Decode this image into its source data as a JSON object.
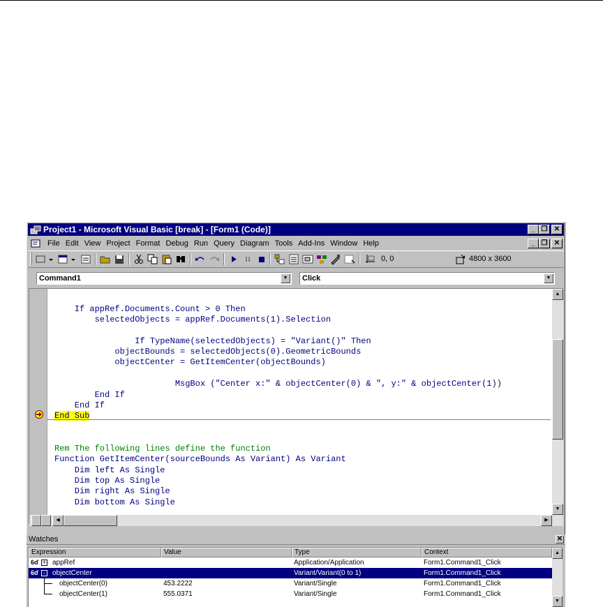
{
  "window": {
    "title": "Project1 - Microsoft Visual Basic [break] - [Form1 (Code)]"
  },
  "menu": [
    "File",
    "Edit",
    "View",
    "Project",
    "Format",
    "Debug",
    "Run",
    "Query",
    "Diagram",
    "Tools",
    "Add-Ins",
    "Window",
    "Help"
  ],
  "toolbar": {
    "position_readout": "0, 0",
    "size_readout": "4800 x 3600"
  },
  "code_window": {
    "object_combo": "Command1",
    "procedure_combo": "Click",
    "lines": [
      {
        "text": "    If appRef.Documents.Count > 0 Then",
        "style": "code"
      },
      {
        "text": "        selectedObjects = appRef.Documents(1).Selection",
        "style": "code"
      },
      {
        "text": "",
        "style": "code"
      },
      {
        "text": "                If TypeName(selectedObjects) = \"Variant()\" Then",
        "style": "code"
      },
      {
        "text": "            objectBounds = selectedObjects(0).GeometricBounds",
        "style": "code"
      },
      {
        "text": "            objectCenter = GetItemCenter(objectBounds)",
        "style": "code"
      },
      {
        "text": "",
        "style": "code"
      },
      {
        "text": "                        MsgBox (\"Center x:\" & objectCenter(0) & \", y:\" & objectCenter(1))",
        "style": "code"
      },
      {
        "text": "        End If",
        "style": "code"
      },
      {
        "text": "    End If",
        "style": "code"
      },
      {
        "text": "End Sub",
        "style": "current"
      },
      {
        "text": "",
        "style": "code"
      },
      {
        "text": "",
        "style": "code"
      },
      {
        "text": "Rem The following lines define the function",
        "style": "comment"
      },
      {
        "text": "Function GetItemCenter(sourceBounds As Variant) As Variant",
        "style": "code"
      },
      {
        "text": "    Dim left As Single",
        "style": "code"
      },
      {
        "text": "    Dim top As Single",
        "style": "code"
      },
      {
        "text": "    Dim right As Single",
        "style": "code"
      },
      {
        "text": "    Dim bottom As Single",
        "style": "code"
      }
    ]
  },
  "watches": {
    "title": "Watches",
    "columns": [
      "Expression",
      "Value",
      "Type",
      "Context"
    ],
    "rows": [
      {
        "expression": "appRef",
        "value": "",
        "type": "Application/Application",
        "context": "Form1.Command1_Click",
        "selected": false,
        "level": 0,
        "toggle": "+"
      },
      {
        "expression": "objectCenter",
        "value": "",
        "type": "Variant/Variant(0 to 1)",
        "context": "Form1.Command1_Click",
        "selected": true,
        "level": 0,
        "toggle": "-"
      },
      {
        "expression": "objectCenter(0)",
        "value": "453.2222",
        "type": "Variant/Single",
        "context": "Form1.Command1_Click",
        "selected": false,
        "level": 1,
        "toggle": ""
      },
      {
        "expression": "objectCenter(1)",
        "value": "555.0371",
        "type": "Variant/Single",
        "context": "Form1.Command1_Click",
        "selected": false,
        "level": 1,
        "toggle": ""
      }
    ]
  },
  "icons": {
    "app": "vb-project-icon",
    "breakpoint": "current-line-arrow-icon",
    "watch": "glasses-icon"
  },
  "colors": {
    "titlebar": "#000080",
    "code_keyword": "#000080",
    "comment": "#008000",
    "current_line": "#ffff00",
    "chrome": "#c0c0c0"
  }
}
